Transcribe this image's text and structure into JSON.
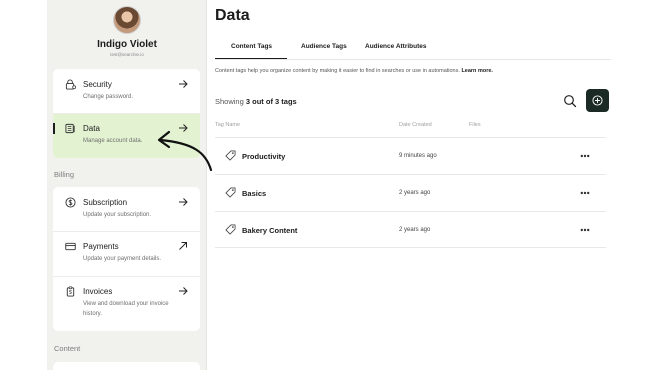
{
  "user": {
    "name": "Indigo Violet",
    "email": "test@searchie.io"
  },
  "sidebar": {
    "account_items": [
      {
        "title": "Security",
        "subtitle": "Change password.",
        "icon": "lock-icon"
      },
      {
        "title": "Data",
        "subtitle": "Manage account data.",
        "icon": "data-icon"
      }
    ],
    "billing_label": "Billing",
    "billing_items": [
      {
        "title": "Subscription",
        "subtitle": "Update your subscription.",
        "icon": "dollar-icon"
      },
      {
        "title": "Payments",
        "subtitle": "Update your payment details.",
        "icon": "credit-card-icon"
      },
      {
        "title": "Invoices",
        "subtitle": "View and download your invoice history.",
        "icon": "invoice-icon"
      }
    ],
    "content_label": "Content"
  },
  "main": {
    "title": "Data",
    "tabs": [
      "Content Tags",
      "Audience Tags",
      "Audience Attributes"
    ],
    "helper_text": "Content tags help you organize content by making it easier to find in searches or use in automations.",
    "helper_link": "Learn more.",
    "showing_prefix": "Showing",
    "showing_count": "3 out of 3 tags",
    "columns": [
      "Tag Name",
      "Date Created",
      "Files"
    ],
    "rows": [
      {
        "name": "Productivity",
        "date": "9 minutes ago"
      },
      {
        "name": "Basics",
        "date": "2 years ago"
      },
      {
        "name": "Bakery Content",
        "date": "2 years ago"
      }
    ]
  },
  "colors": {
    "accent": "#1b2a24",
    "active_item_bg": "#e3f3d1",
    "sidebar_bg": "#f1f1ee"
  }
}
